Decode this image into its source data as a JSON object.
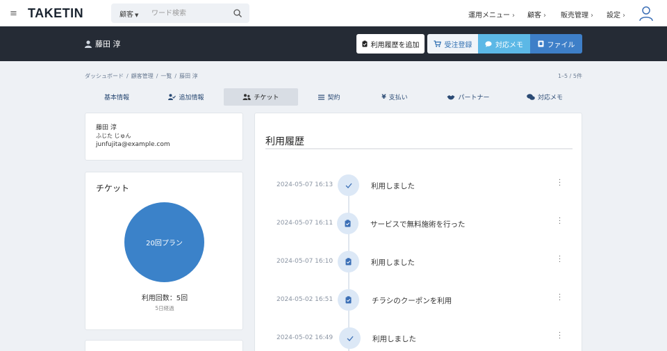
{
  "topnav": {
    "logo": "TAKETIN",
    "search": {
      "scope": "顧客",
      "placeholder": "ワード検索"
    },
    "menu": [
      {
        "label": "運用メニュー"
      },
      {
        "label": "顧客"
      },
      {
        "label": "販売管理"
      },
      {
        "label": "設定"
      }
    ],
    "chevron": "›"
  },
  "header": {
    "customer_name": "藤田 淳",
    "buttons": {
      "add_history": "利用履歴を追加",
      "order": "受注登録",
      "memo": "対応メモ",
      "file": "ファイル"
    },
    "colors": {
      "memo": "#5cb8e6",
      "file": "#3e7fc8",
      "bar": "#252b35"
    }
  },
  "breadcrumb": [
    "ダッシュボード",
    "顧客管理",
    "一覧",
    "藤田 淳"
  ],
  "breadcrumb_sep": "/",
  "count": "1–5 / 5件",
  "tabs": [
    {
      "label": "基本情報",
      "icon": "none"
    },
    {
      "label": "追加情報",
      "icon": "user-check-icon"
    },
    {
      "label": "チケット",
      "icon": "users-icon",
      "active": true
    },
    {
      "label": "契約",
      "icon": "list-icon"
    },
    {
      "label": "支払い",
      "icon": "yen-icon"
    },
    {
      "label": "パートナー",
      "icon": "handshake-icon"
    },
    {
      "label": "対応メモ",
      "icon": "comments-icon"
    }
  ],
  "profile": {
    "name": "藤田 淳",
    "kana": "ふじた じゅん",
    "email": "junfujita@example.com"
  },
  "ticket": {
    "title": "チケット",
    "plan": "20回プラン",
    "usage": "利用回数：5回",
    "elapsed": "5日経過"
  },
  "history": {
    "title": "利用履歴",
    "entries": [
      {
        "time": "2024-05-07 16:13",
        "icon": "check-icon",
        "text": "利用しました"
      },
      {
        "time": "2024-05-07 16:11",
        "icon": "clipboard-icon",
        "text": "サービスで無料施術を行った"
      },
      {
        "time": "2024-05-07 16:10",
        "icon": "clipboard-icon",
        "text": "利用しました"
      },
      {
        "time": "2024-05-02 16:51",
        "icon": "clipboard-icon",
        "text": "チラシのクーポンを利用"
      },
      {
        "time": "2024-05-02 16:49",
        "icon": "check-icon",
        "text": "利用しました"
      }
    ]
  }
}
